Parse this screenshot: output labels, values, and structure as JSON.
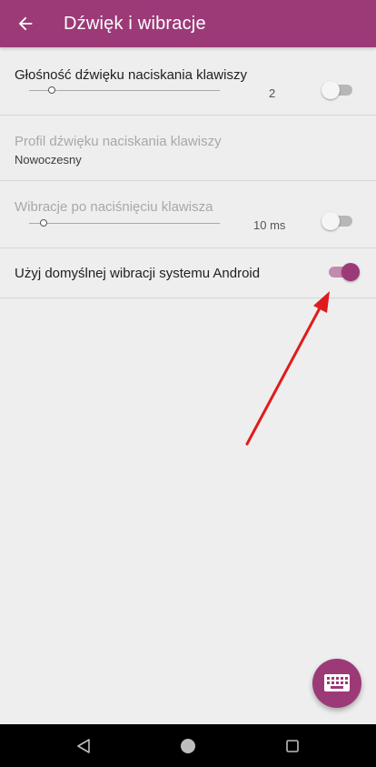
{
  "appbar": {
    "title": "Dźwięk i wibracje",
    "back_icon": "arrow-back-icon"
  },
  "settings": {
    "key_volume": {
      "title": "Głośność dźwięku naciskania klawiszy",
      "value": "2",
      "slider_fraction": 0.12,
      "enabled": false
    },
    "sound_profile": {
      "title": "Profil dźwięku naciskania klawiszy",
      "value": "Nowoczesny"
    },
    "vibration": {
      "title": "Wibracje po naciśnięciu klawisza",
      "value": "10 ms",
      "slider_fraction": 0.08,
      "enabled": false
    },
    "system_vibration": {
      "title": "Użyj domyślnej wibracji systemu Android",
      "enabled": true
    }
  },
  "fab": {
    "icon": "keyboard-icon"
  },
  "navbar": {
    "back": "nav-back-icon",
    "home": "nav-home-icon",
    "recents": "nav-recents-icon"
  },
  "colors": {
    "primary": "#9c3a78",
    "switch_on_track": "#c38ab0",
    "annotation_arrow": "#e01b1b"
  }
}
